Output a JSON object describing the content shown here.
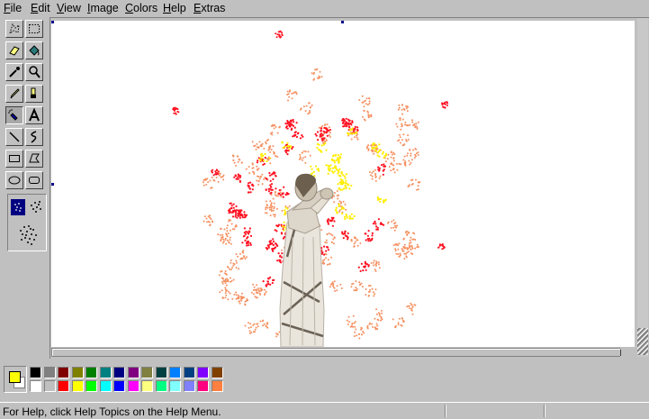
{
  "menu": {
    "items": [
      "File",
      "Edit",
      "View",
      "Image",
      "Colors",
      "Help",
      "Extras"
    ]
  },
  "tools": [
    {
      "name": "free-form-select",
      "icon": "freeform-select-icon"
    },
    {
      "name": "select",
      "icon": "rect-select-icon"
    },
    {
      "name": "eraser",
      "icon": "eraser-icon"
    },
    {
      "name": "fill-with-color",
      "icon": "paint-bucket-icon"
    },
    {
      "name": "pick-color",
      "icon": "eyedropper-icon"
    },
    {
      "name": "magnifier",
      "icon": "magnifier-icon"
    },
    {
      "name": "pencil",
      "icon": "pencil-icon"
    },
    {
      "name": "brush",
      "icon": "brush-icon"
    },
    {
      "name": "airbrush",
      "icon": "airbrush-icon",
      "active": true
    },
    {
      "name": "text",
      "icon": "text-icon",
      "glyph": "A"
    },
    {
      "name": "line",
      "icon": "line-icon"
    },
    {
      "name": "curve",
      "icon": "curve-icon"
    },
    {
      "name": "rectangle",
      "icon": "rectangle-icon"
    },
    {
      "name": "polygon",
      "icon": "polygon-icon"
    },
    {
      "name": "ellipse",
      "icon": "ellipse-icon"
    },
    {
      "name": "rounded-rectangle",
      "icon": "rounded-rectangle-icon"
    }
  ],
  "airbrush_sizes": [
    "small-spray-icon",
    "medium-spray-icon",
    "large-spray-icon"
  ],
  "colors": {
    "foreground": "#ffff00",
    "background": "#ffffff",
    "palette_top": [
      "#000000",
      "#808080",
      "#800000",
      "#808000",
      "#008000",
      "#008080",
      "#000080",
      "#800080",
      "#808040",
      "#004040",
      "#0080ff",
      "#004080",
      "#8000ff",
      "#804000"
    ],
    "palette_bottom": [
      "#ffffff",
      "#c0c0c0",
      "#ff0000",
      "#ffff00",
      "#00ff00",
      "#00ffff",
      "#0000ff",
      "#ff00ff",
      "#ffff80",
      "#00ff80",
      "#80ffff",
      "#8080ff",
      "#ff0080",
      "#ff8040"
    ]
  },
  "status": {
    "help_text": "For Help, click Help Topics on the Help Menu."
  }
}
